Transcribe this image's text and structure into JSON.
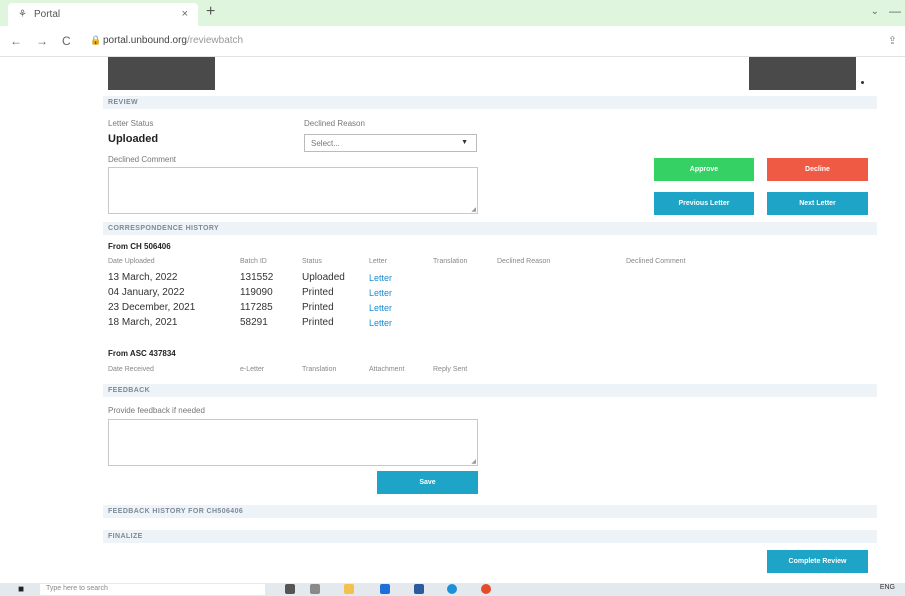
{
  "browser": {
    "tab_title": "Portal",
    "tab_close": "×",
    "new_tab": "+",
    "tab_list": "⌄",
    "window_minimize": "—",
    "back": "←",
    "forward": "→",
    "reload": "C",
    "url_host": "portal.unbound.org",
    "url_path": "/reviewbatch",
    "share": "⇪"
  },
  "review": {
    "section_title": "REVIEW",
    "letter_status_label": "Letter Status",
    "letter_status_value": "Uploaded",
    "declined_reason_label": "Declined Reason",
    "declined_reason_value": "Select...",
    "declined_comment_label": "Declined Comment",
    "approve_label": "Approve",
    "decline_label": "Decline",
    "previous_letter_label": "Previous Letter",
    "next_letter_label": "Next Letter"
  },
  "history": {
    "section_title": "CORRESPONDENCE HISTORY",
    "group1_title": "From CH 506406",
    "columns": [
      "Date Uploaded",
      "Batch ID",
      "Status",
      "Letter",
      "Translation",
      "Declined Reason",
      "Declined Comment"
    ],
    "rows": [
      {
        "date": "13 March, 2022",
        "batch": "131552",
        "status": "Uploaded",
        "letter": "Letter"
      },
      {
        "date": "04 January, 2022",
        "batch": "119090",
        "status": "Printed",
        "letter": "Letter"
      },
      {
        "date": "23 December, 2021",
        "batch": "117285",
        "status": "Printed",
        "letter": "Letter"
      },
      {
        "date": "18 March, 2021",
        "batch": "58291",
        "status": "Printed",
        "letter": "Letter"
      }
    ],
    "group2_title": "From ASC 437834",
    "group2_columns": [
      "Date Received",
      "e-Letter",
      "Translation",
      "Attachment",
      "Reply Sent"
    ]
  },
  "feedback": {
    "section_title": "FEEDBACK",
    "prompt_label": "Provide feedback if needed",
    "save_label": "Save"
  },
  "feedback_history": {
    "section_title": "FEEDBACK HISTORY FOR CH506406"
  },
  "finalize": {
    "section_title": "FINALIZE",
    "complete_label": "Complete Review"
  },
  "taskbar": {
    "search_placeholder": "Type here to search",
    "language": "ENG"
  }
}
